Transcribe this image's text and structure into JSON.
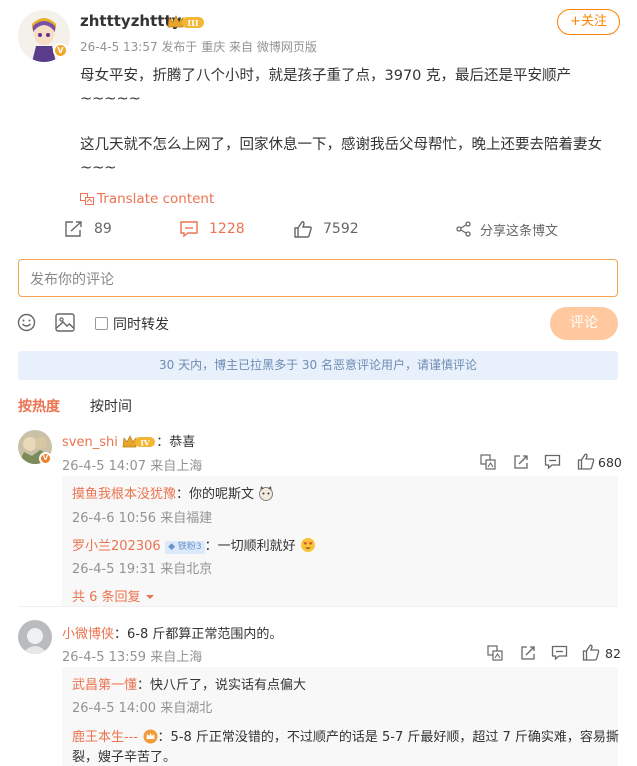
{
  "post": {
    "username": "zhtttyzhttty",
    "level": "III",
    "meta": "26-4-5 13:57  发布于 重庆  来自 微博网页版",
    "follow_label": "+关注",
    "line1": "母女平安，折腾了八个小时，就是孩子重了点，3970 克，最后还是平安顺产",
    "line2": "~~~~~",
    "line3": "这几天就不怎么上网了，回家休息一下，感谢我岳父母帮忙，晚上还要去陪着妻女",
    "line4": "~~~",
    "translate": "Translate content",
    "reposts": "89",
    "comments": "1228",
    "likes": "7592",
    "share": "分享这条博文"
  },
  "composer": {
    "placeholder": "发布你的评论",
    "also_repost": "同时转发",
    "submit": "评论"
  },
  "notice": "30 天内，博主已拉黑多于 30 名恶意评论用户，请谨慎评论",
  "sort": {
    "hot": "按热度",
    "time": "按时间"
  },
  "comments": [
    {
      "name": "sven_shi",
      "level": "IV",
      "text": "：恭喜",
      "meta": "26-4-5 14:07  来自上海",
      "likes": "680",
      "replies": [
        {
          "name": "摸鱼我根本没犹豫",
          "text": "：你的呢斯文",
          "meta": "26-4-6 10:56  来自福建"
        },
        {
          "name": "罗小兰202306",
          "badge": "铁粉3",
          "text": "：一切顺利就好",
          "meta": "26-4-5 19:31  来自北京"
        }
      ],
      "more": "共 6 条回复"
    },
    {
      "name": "小微博侠",
      "text": "：6-8 斤都算正常范围内的。",
      "meta": "26-4-5 13:59  来自上海",
      "likes": "82",
      "replies": [
        {
          "name": "武昌第一懂",
          "text": "：快八斤了，说实话有点偏大",
          "meta": "26-4-5 14:00  来自湖北"
        },
        {
          "name": "鹿王本生---",
          "text": "：5-8 斤正常没错的，不过顺产的话是 5-7 斤最好顺，超过 7 斤确实难，容易撕",
          "text2": "裂，嫂子辛苦了。"
        }
      ]
    }
  ]
}
